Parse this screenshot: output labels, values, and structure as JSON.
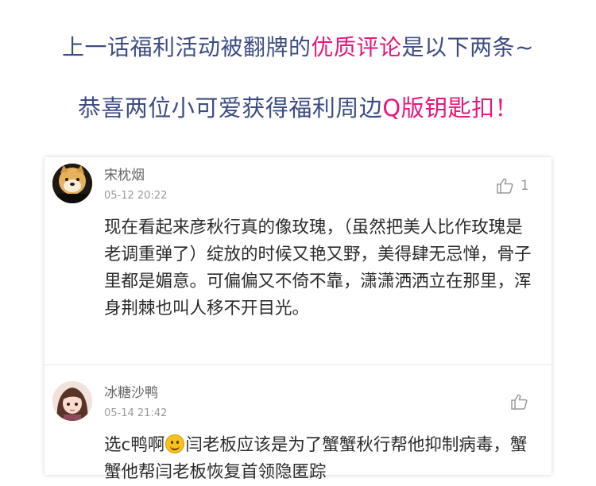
{
  "headline": {
    "line1_prefix": "上一话福利活动被翻牌的",
    "line1_highlight": "优质评论",
    "line1_suffix": "是以下两条~",
    "line2_prefix": "恭喜两位小可爱获得福利周边",
    "line2_highlight": "Q版钥匙扣！"
  },
  "colors": {
    "headline": "#3d4d82",
    "highlight": "#e7177c"
  },
  "comments": [
    {
      "username": "宋枕烟",
      "timestamp": "05-12 20:22",
      "likes": "1",
      "text": "现在看起来彦秋行真的像玫瑰，（虽然把美人比作玫瑰是老调重弹了）绽放的时候又艳又野，美得肆无忌惮，骨子里都是媚意。可偏偏又不倚不靠，潇潇洒洒立在那里，浑身荆棘也叫人移不开目光。",
      "avatar_icon": "shiba-dog-avatar"
    },
    {
      "username": "冰糖沙鸭",
      "timestamp": "05-14 21:42",
      "likes": "",
      "text_before_emoji": "选c鸭啊",
      "emoji": "smiley-icon",
      "text_after_emoji": "闫老板应该是为了蟹蟹秋行帮他抑制病毒，蟹蟹他帮闫老板恢复首领隐匿踪",
      "avatar_icon": "anime-girl-avatar"
    }
  ]
}
